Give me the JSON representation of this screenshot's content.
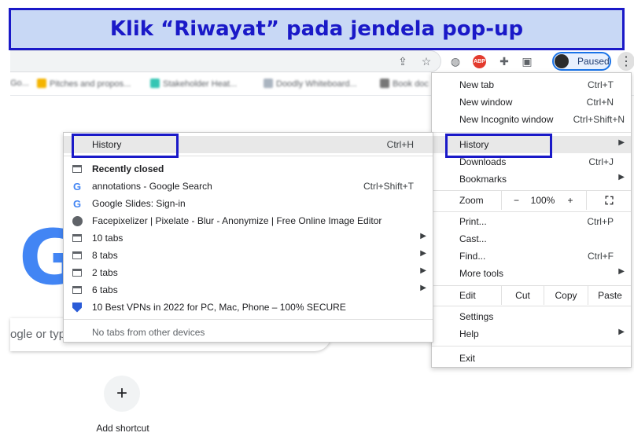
{
  "banner": {
    "text": "Klik “Riwayat” pada jendela pop-up"
  },
  "toolbar": {
    "icons": [
      "share-icon",
      "star-icon",
      "globe-icon",
      "adblock-icon",
      "puzzle-icon",
      "sidepanel-icon"
    ],
    "adblock_label": "ABP",
    "profile_label": "Paused"
  },
  "bookmarks": [
    "Go...",
    "Pitches and propos...",
    "Stakeholder Heat...",
    "Doodly Whiteboard...",
    "Book doc"
  ],
  "ntp": {
    "logo_letter": "G",
    "search_placeholder": "ogle or typ",
    "add_shortcut_label": "Add shortcut"
  },
  "menu": {
    "new_tab": {
      "label": "New tab",
      "shortcut": "Ctrl+T"
    },
    "new_window": {
      "label": "New window",
      "shortcut": "Ctrl+N"
    },
    "new_incognito": {
      "label": "New Incognito window",
      "shortcut": "Ctrl+Shift+N"
    },
    "history": {
      "label": "History"
    },
    "downloads": {
      "label": "Downloads",
      "shortcut": "Ctrl+J"
    },
    "bookmarks": {
      "label": "Bookmarks"
    },
    "zoom": {
      "label": "Zoom",
      "minus": "−",
      "value": "100%",
      "plus": "+"
    },
    "print": {
      "label": "Print...",
      "shortcut": "Ctrl+P"
    },
    "cast": {
      "label": "Cast..."
    },
    "find": {
      "label": "Find...",
      "shortcut": "Ctrl+F"
    },
    "more_tools": {
      "label": "More tools"
    },
    "edit": {
      "label": "Edit",
      "cut": "Cut",
      "copy": "Copy",
      "paste": "Paste"
    },
    "settings": {
      "label": "Settings"
    },
    "help": {
      "label": "Help"
    },
    "exit": {
      "label": "Exit"
    }
  },
  "history_submenu": {
    "history": {
      "label": "History",
      "shortcut": "Ctrl+H"
    },
    "recently_closed": "Recently closed",
    "items": [
      {
        "label": "annotations - Google Search",
        "shortcut": "Ctrl+Shift+T",
        "icon": "google-icon"
      },
      {
        "label": "Google Slides: Sign-in",
        "icon": "google-icon"
      },
      {
        "label": "Facepixelizer | Pixelate - Blur - Anonymize | Free Online Image Editor",
        "icon": "globe-icon"
      },
      {
        "label": "10 tabs",
        "icon": "tab-group-icon"
      },
      {
        "label": "8 tabs",
        "icon": "tab-group-icon"
      },
      {
        "label": "2 tabs",
        "icon": "tab-group-icon"
      },
      {
        "label": "6 tabs",
        "icon": "tab-group-icon"
      },
      {
        "label": "10 Best VPNs in 2022 for PC, Mac,  Phone – 100% SECURE",
        "icon": "shield-icon"
      }
    ],
    "no_tabs": "No tabs from other devices"
  },
  "colors": {
    "highlight": "#1a19c8",
    "banner_bg": "#c8d8f5",
    "google_blue": "#4285f4"
  }
}
